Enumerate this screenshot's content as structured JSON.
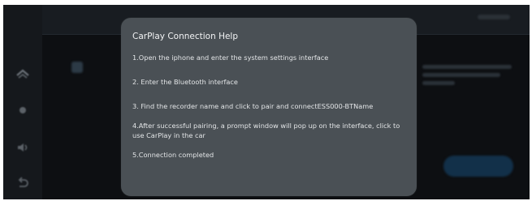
{
  "dialog": {
    "title": "CarPlay Connection Help",
    "steps": [
      "1.Open the iphone and enter the system settings interface",
      "2. Enter the Bluetooth interface",
      "3. Find the recorder name and click to pair and connectESS000-BTName",
      "4.After successful pairing, a prompt window will pop up on the interface, click to use CarPlay in the car",
      "5.Connection completed"
    ]
  },
  "sidebar": {
    "icons": [
      "home-icon",
      "navigation-icon",
      "volume-icon",
      "back-icon"
    ]
  }
}
